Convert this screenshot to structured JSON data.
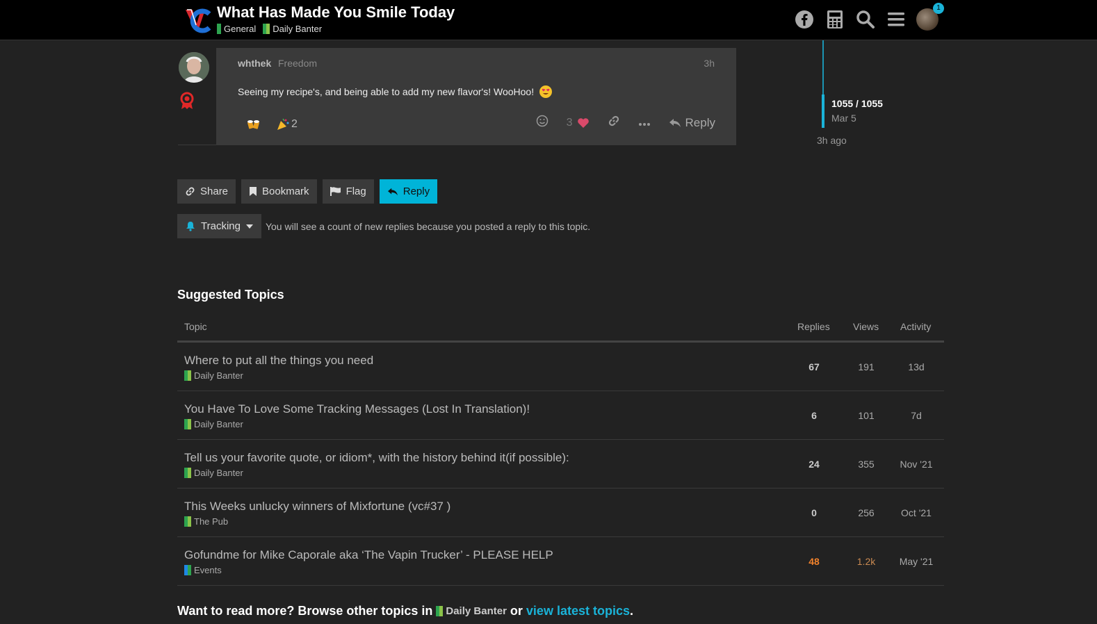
{
  "header": {
    "title": "What Has Made You Smile Today",
    "categories": [
      {
        "label": "General",
        "color": "#2ea44f"
      },
      {
        "label": "Daily Banter",
        "color": "#8bc34a"
      }
    ],
    "icons": [
      "facebook-icon",
      "calculator-icon",
      "search-icon",
      "hamburger-menu-icon",
      "user-avatar"
    ],
    "notification_count": "1"
  },
  "post": {
    "username": "whthek",
    "user_title": "Freedom",
    "time": "3h",
    "body": "Seeing my recipe's, and being able to add my new flavor's! WooHoo!",
    "reactions": [
      {
        "icon": "beers-emoji",
        "count": ""
      },
      {
        "icon": "party-popper-emoji",
        "count": "2"
      }
    ],
    "like_count": "3",
    "reply_label": "Reply"
  },
  "timeline": {
    "count": "1055 / 1055",
    "date": "Mar 5",
    "ago": "3h ago"
  },
  "footer_buttons": {
    "share": "Share",
    "bookmark": "Bookmark",
    "flag": "Flag",
    "reply": "Reply"
  },
  "tracking": {
    "label": "Tracking",
    "message": "You will see a count of new replies because you posted a reply to this topic."
  },
  "suggested": {
    "title": "Suggested Topics",
    "headers": {
      "topic": "Topic",
      "replies": "Replies",
      "views": "Views",
      "activity": "Activity"
    },
    "rows": [
      {
        "title": "Where to put all the things you need",
        "category": "Daily Banter",
        "replies": "67",
        "views": "191",
        "activity": "13d"
      },
      {
        "title": "You Have To Love Some Tracking Messages (Lost In Translation)!",
        "category": "Daily Banter",
        "replies": "6",
        "views": "101",
        "activity": "7d"
      },
      {
        "title": "Tell us your favorite quote, or idiom*, with the history behind it(if possible):",
        "category": "Daily Banter",
        "replies": "24",
        "views": "355",
        "activity": "Nov '21"
      },
      {
        "title": "This Weeks unlucky winners of Mixfortune (vc#37 )",
        "category": "The Pub",
        "replies": "0",
        "views": "256",
        "activity": "Oct '21"
      },
      {
        "title": "Gofundme for Mike Caporale aka ‘The Vapin Trucker’ - PLEASE HELP",
        "category": "Events",
        "replies": "48",
        "views": "1.2k",
        "activity": "May '21"
      }
    ]
  },
  "browse": {
    "prefix": "Want to read more? Browse other topics in",
    "category": "Daily Banter",
    "or": "or",
    "link": "view latest topics",
    "suffix": "."
  }
}
